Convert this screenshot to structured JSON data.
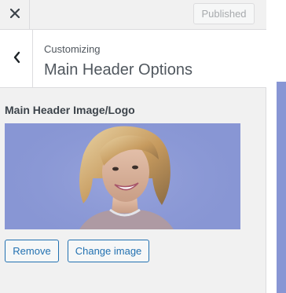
{
  "topbar": {
    "close_icon": "close-icon",
    "publish_label": "Published"
  },
  "header": {
    "back_icon": "chevron-left-icon",
    "breadcrumb": "Customizing",
    "title": "Main Header Options"
  },
  "control": {
    "label": "Main Header Image/Logo",
    "image_icon": "header-logo-image",
    "remove_label": "Remove",
    "change_label": "Change image"
  },
  "colors": {
    "accent": "#2271b1",
    "image_background": "#8896d4",
    "panel_background": "#f1f1f1"
  }
}
